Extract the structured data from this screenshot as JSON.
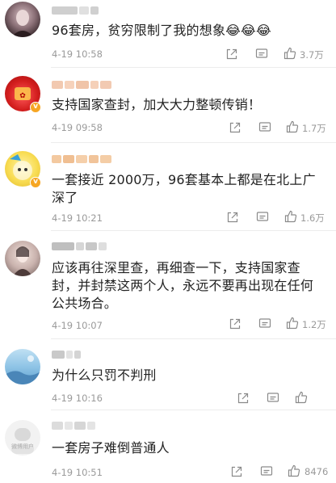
{
  "comments": [
    {
      "text": "96套房，贫穷限制了我的想象😂😂😂",
      "time": "4-19 10:58",
      "likes": "3.7万"
    },
    {
      "text": "支持国家查封，加大大力整顿传销！",
      "time": "4-19 09:58",
      "likes": "1.7万"
    },
    {
      "text": "一套接近 2000万，96套基本上都是在北上广深了",
      "time": "4-19 10:21",
      "likes": "1.6万"
    },
    {
      "text": "应该再往深里查，再细查一下，支持国家查封，并封禁这两个人，永远不要再出现在任何公共场合。",
      "time": "4-19 10:07",
      "likes": "1.2万"
    },
    {
      "text": "为什么只罚不判刑",
      "time": "4-19 10:16",
      "likes": ""
    },
    {
      "text": "一套房子难倒普通人",
      "time": "4-19 10:51",
      "likes": "8476"
    }
  ],
  "avatar_watermark": "微博用户",
  "icons": {
    "share": "share-icon",
    "comment": "comment-icon",
    "like": "like-icon",
    "verified": "verified-badge-icon"
  },
  "colors": {
    "text": "#222222",
    "meta": "#9a9a9a",
    "verified": "#f6a623",
    "divider": "#ececec"
  }
}
